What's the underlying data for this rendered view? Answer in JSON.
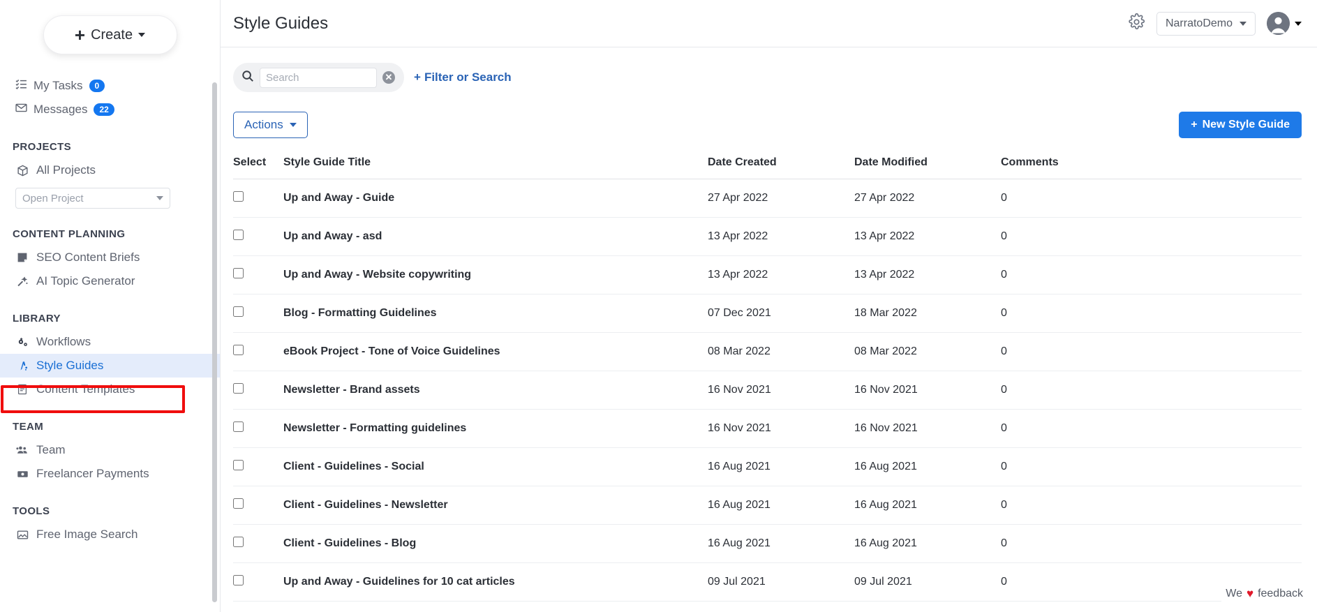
{
  "sidebar": {
    "create_button": {
      "label": "Create",
      "icon": "plus-icon"
    },
    "quick_items": [
      {
        "label": "My Tasks",
        "badge": "0",
        "icon": "tasks-list-icon"
      },
      {
        "label": "Messages",
        "badge": "22",
        "icon": "envelope-icon"
      }
    ],
    "sections": [
      {
        "title": "PROJECTS",
        "items": [
          {
            "label": "All Projects",
            "icon": "cube-icon",
            "active": false
          }
        ],
        "select": {
          "value": "Open Project",
          "icon": "chevron-down-icon"
        }
      },
      {
        "title": "CONTENT PLANNING",
        "items": [
          {
            "label": "SEO Content Briefs",
            "icon": "document-note-icon",
            "active": false
          },
          {
            "label": "AI Topic Generator",
            "icon": "magic-wand-icon",
            "active": false
          }
        ]
      },
      {
        "title": "LIBRARY",
        "items": [
          {
            "label": "Workflows",
            "icon": "gears-icon",
            "active": false
          },
          {
            "label": "Style Guides",
            "icon": "style-guide-icon",
            "active": true
          },
          {
            "label": "Content Templates",
            "icon": "template-doc-icon",
            "active": false
          }
        ]
      },
      {
        "title": "TEAM",
        "items": [
          {
            "label": "Team",
            "icon": "people-icon",
            "active": false
          },
          {
            "label": "Freelancer Payments",
            "icon": "payment-card-icon",
            "active": false
          }
        ]
      },
      {
        "title": "TOOLS",
        "items": [
          {
            "label": "Free Image Search",
            "icon": "image-icon",
            "active": false
          }
        ]
      }
    ]
  },
  "header": {
    "title": "Style Guides",
    "gear_icon": "gear-icon",
    "org": {
      "label": "NarratoDemo",
      "icon": "chevron-down-icon"
    },
    "avatar": {
      "icon": "user-avatar-icon",
      "caret": "chevron-down-icon"
    }
  },
  "toolbar": {
    "search": {
      "placeholder": "Search",
      "value": "",
      "icon": "search-icon",
      "clear_icon": "clear-circle-icon"
    },
    "filter_link": {
      "label": "Filter or Search",
      "icon": "plus-icon"
    },
    "actions_button": {
      "label": "Actions",
      "icon": "chevron-down-icon"
    },
    "new_button": {
      "label": "New Style Guide",
      "icon": "plus-icon"
    }
  },
  "table": {
    "columns": [
      "Select",
      "Style Guide Title",
      "Date Created",
      "Date Modified",
      "Comments"
    ],
    "rows": [
      {
        "title": "Up and Away - Guide",
        "created": "27 Apr 2022",
        "modified": "27 Apr 2022",
        "comments": "0",
        "checked": false
      },
      {
        "title": "Up and Away - asd",
        "created": "13 Apr 2022",
        "modified": "13 Apr 2022",
        "comments": "0",
        "checked": false
      },
      {
        "title": "Up and Away - Website copywriting",
        "created": "13 Apr 2022",
        "modified": "13 Apr 2022",
        "comments": "0",
        "checked": false
      },
      {
        "title": "Blog - Formatting Guidelines",
        "created": "07 Dec 2021",
        "modified": "18 Mar 2022",
        "comments": "0",
        "checked": false
      },
      {
        "title": "eBook Project - Tone of Voice Guidelines",
        "created": "08 Mar 2022",
        "modified": "08 Mar 2022",
        "comments": "0",
        "checked": false
      },
      {
        "title": "Newsletter - Brand assets",
        "created": "16 Nov 2021",
        "modified": "16 Nov 2021",
        "comments": "0",
        "checked": false
      },
      {
        "title": "Newsletter - Formatting guidelines",
        "created": "16 Nov 2021",
        "modified": "16 Nov 2021",
        "comments": "0",
        "checked": false
      },
      {
        "title": "Client - Guidelines - Social",
        "created": "16 Aug 2021",
        "modified": "16 Aug 2021",
        "comments": "0",
        "checked": false
      },
      {
        "title": "Client - Guidelines - Newsletter",
        "created": "16 Aug 2021",
        "modified": "16 Aug 2021",
        "comments": "0",
        "checked": false
      },
      {
        "title": "Client - Guidelines - Blog",
        "created": "16 Aug 2021",
        "modified": "16 Aug 2021",
        "comments": "0",
        "checked": false
      },
      {
        "title": "Up and Away - Guidelines for 10 cat articles",
        "created": "09 Jul 2021",
        "modified": "09 Jul 2021",
        "comments": "0",
        "checked": false
      }
    ]
  },
  "feedback": {
    "pre": "We",
    "heart": "♥",
    "post": "feedback"
  },
  "colors": {
    "accent_blue": "#1e7ae8",
    "link_blue": "#2a63b5",
    "active_bg": "#e4ecfb",
    "annotation_red": "#f00d0d",
    "badge_blue": "#1477f0",
    "heart_red": "#e0192a"
  }
}
